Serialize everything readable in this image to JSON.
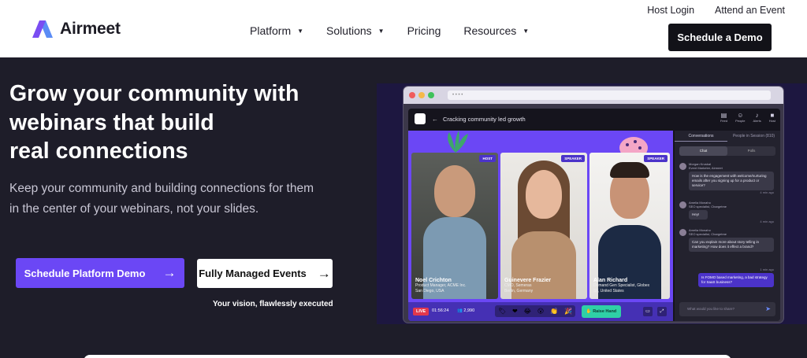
{
  "brand": {
    "name": "Airmeet",
    "colors": {
      "accent": "#6b47f5",
      "dark": "#1e1d29",
      "raise": "#2fd0a6",
      "live": "#e2384d"
    }
  },
  "nav": {
    "items": [
      {
        "label": "Platform",
        "has_dropdown": true
      },
      {
        "label": "Solutions",
        "has_dropdown": true
      },
      {
        "label": "Pricing",
        "has_dropdown": false
      },
      {
        "label": "Resources",
        "has_dropdown": true
      }
    ],
    "host_login": "Host Login",
    "attend_event": "Attend an Event",
    "cta": "Schedule a Demo"
  },
  "hero": {
    "title_lines": [
      "Grow your community with",
      "webinars that build",
      "real connections"
    ],
    "subtitle": "Keep your community and building connections for them in the center of your webinars, not your slides.",
    "primary_cta": "Schedule Platform Demo",
    "secondary_cta": "Fully Managed Events",
    "tagline": "Your vision, flawlessly executed"
  },
  "mockup": {
    "session_title": "Cracking community led growth",
    "toolbar": [
      "Feed",
      "People",
      "Alerts",
      "Host"
    ],
    "speakers": [
      {
        "role": "HOST",
        "name": "Noel Crichton",
        "title": "Product Manager, ACME Inc.",
        "location": "San Diego, USA"
      },
      {
        "role": "SPEAKER",
        "name": "Guinevere Frazier",
        "title": "CMO, Semeras",
        "location": "Berlin, Germany"
      },
      {
        "role": "SPEAKER",
        "name": "Alan Richard",
        "title": "Demand Gen Specialist, Globex",
        "location": "SF, United States"
      }
    ],
    "live_label": "LIVE",
    "timer": "01:56:24",
    "viewers": "2,990",
    "raise_hand": "Raise Hand",
    "panel": {
      "tabs": [
        "Conversations",
        "People in Session (810)"
      ],
      "segments": [
        "Chat",
        "Polls"
      ],
      "messages": [
        {
          "author": "Morgan Kruskal",
          "role": "Event Marketer, Airmeet",
          "time": "4 min ago",
          "text": "How is the engagement with welcome/nurturing emails after you signing up for a product or service?"
        },
        {
          "author": "Amelia Monaho",
          "role": "SEO specialist, Chargetme",
          "time": "4 min ago",
          "text": "Hey!"
        },
        {
          "author": "Amelia Monaho",
          "role": "SEO specialist, Chargetme",
          "time": "4 min ago",
          "text": "Can you explain more about story telling in marketing? How does it effect a brand?"
        }
      ],
      "own_message": "Is FOMO based marketing, a bad strategy for SaaS business?",
      "own_time": "1 min ago",
      "input_placeholder": "What would you like to share?"
    }
  }
}
